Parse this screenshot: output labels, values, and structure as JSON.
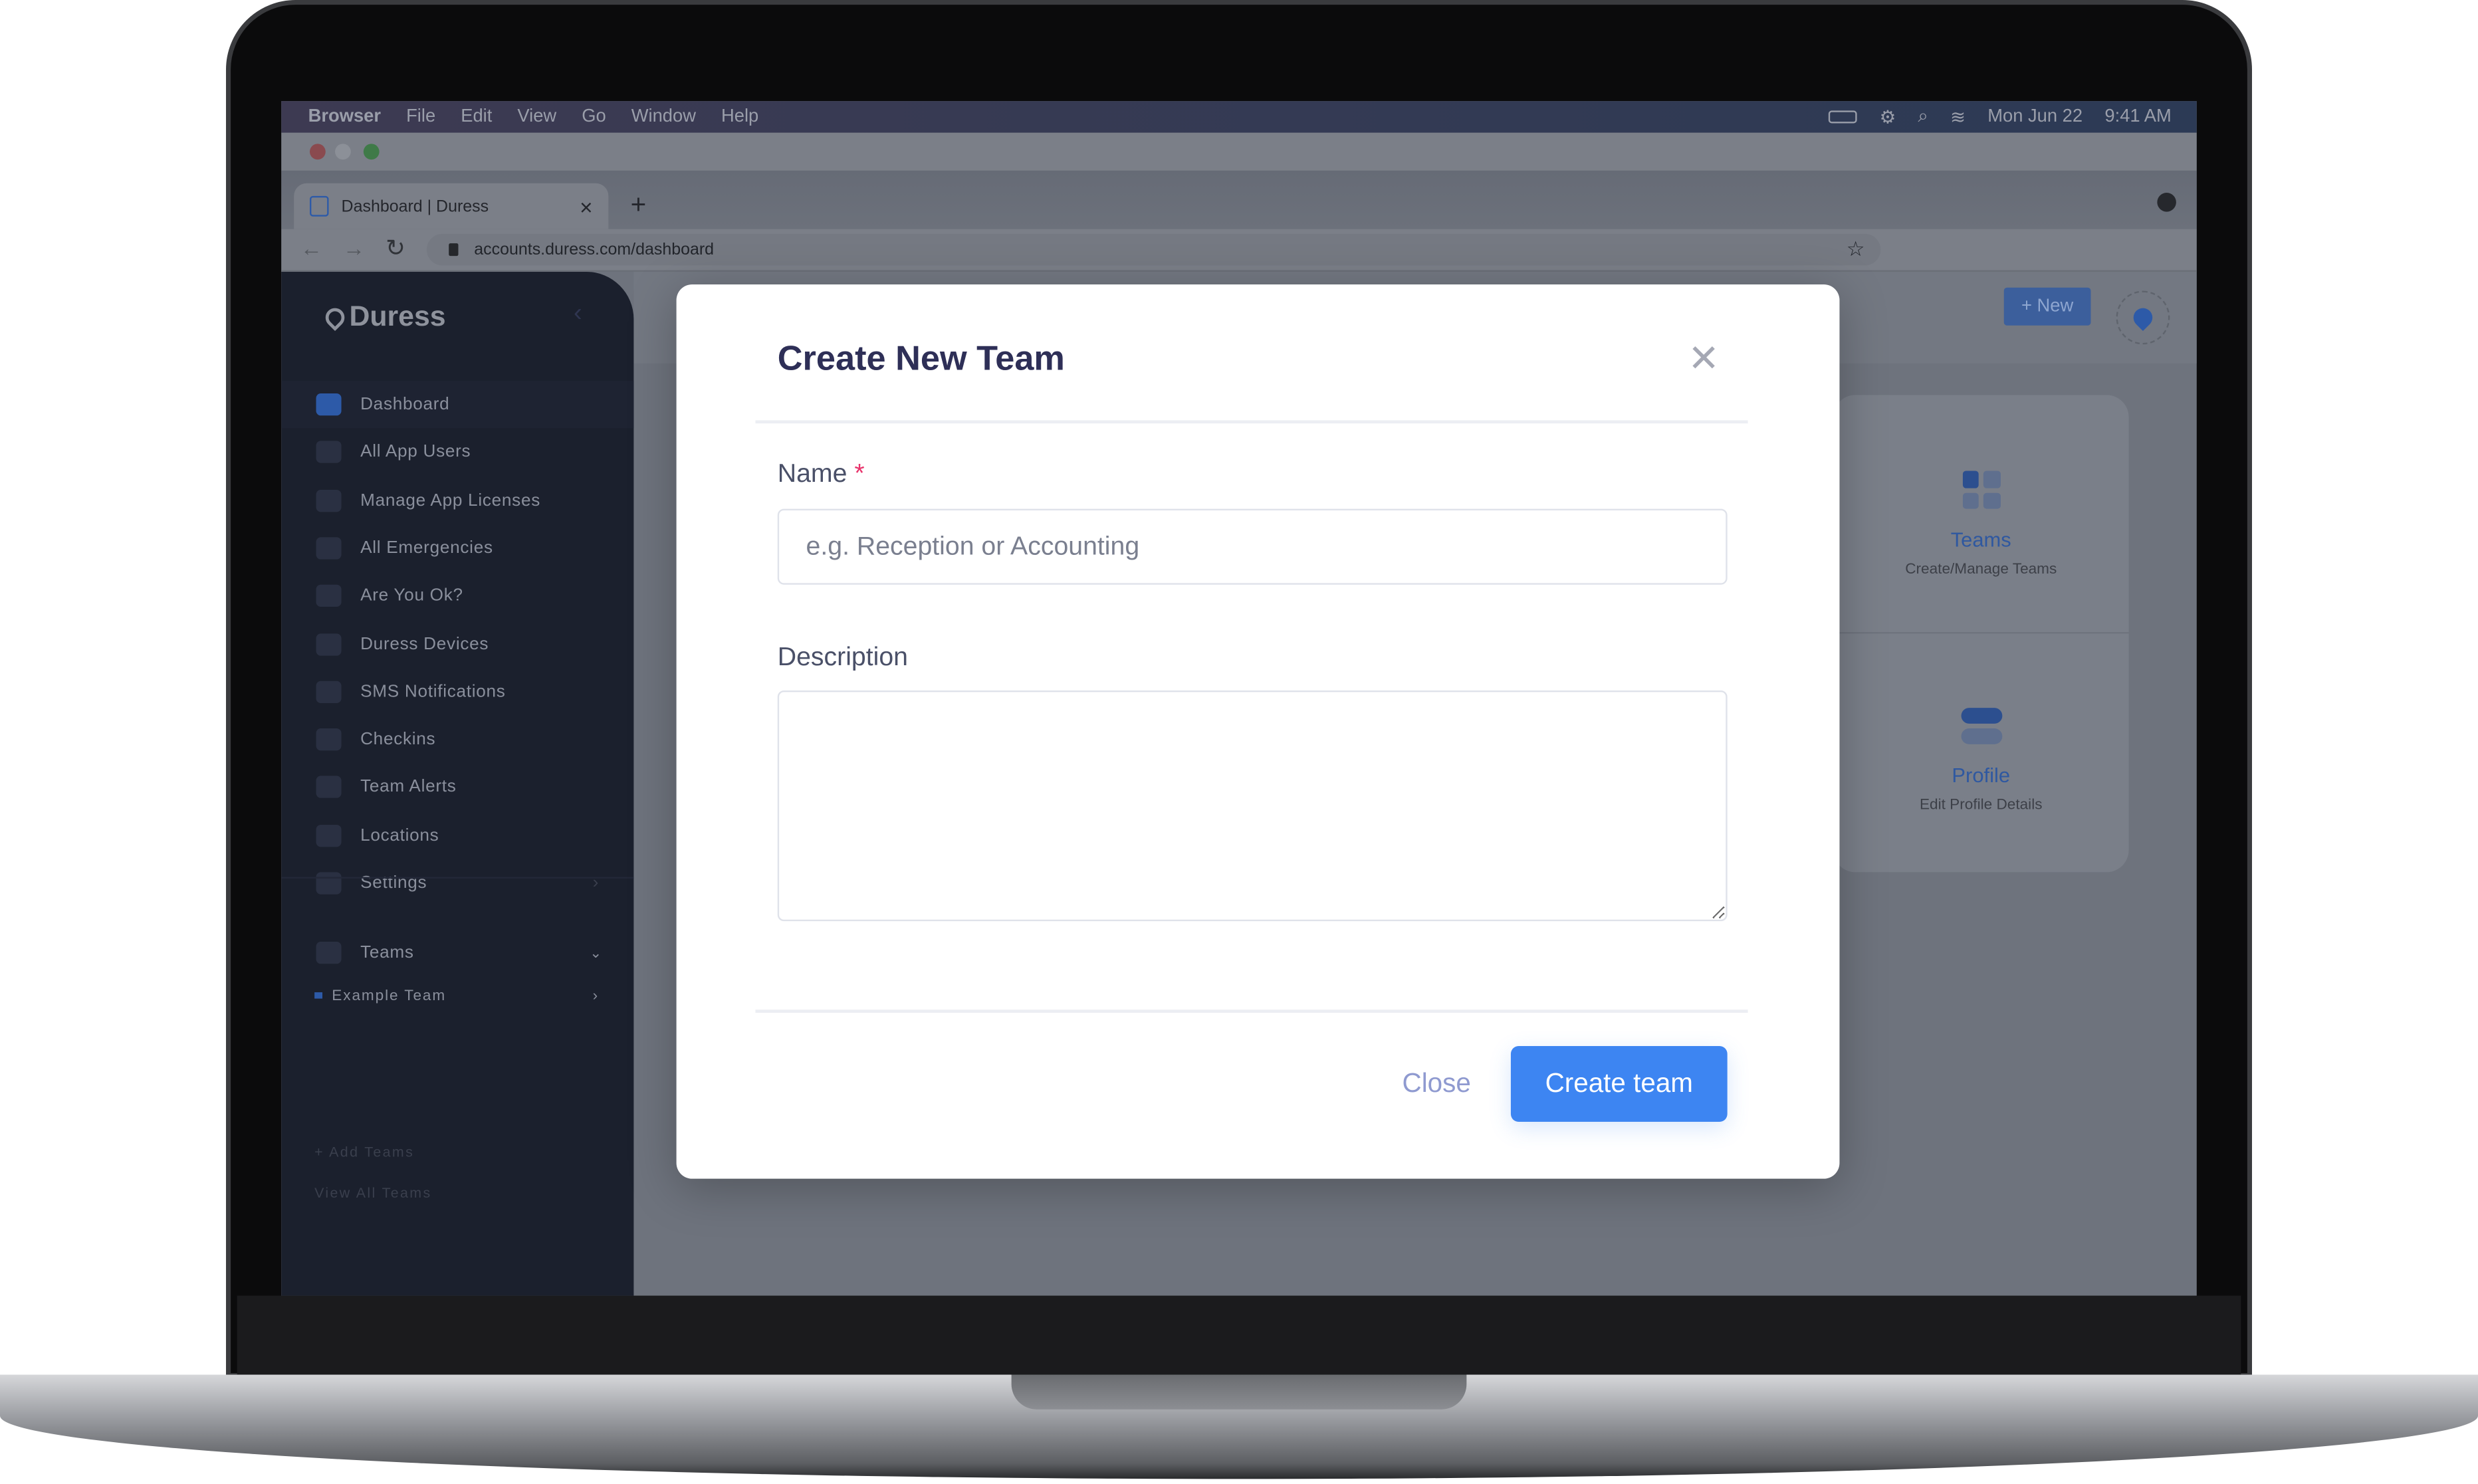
{
  "menubar": {
    "items": [
      "Browser",
      "File",
      "Edit",
      "View",
      "Go",
      "Window",
      "Help"
    ],
    "date": "Mon Jun 22",
    "time": "9:41 AM"
  },
  "browser": {
    "tab_title": "Dashboard | Duress",
    "tab_close": "×",
    "new_tab": "+",
    "url": "accounts.duress.com/dashboard"
  },
  "sidebar": {
    "brand": "Duress",
    "items": [
      {
        "label": "Dashboard",
        "icon": "layers-icon"
      },
      {
        "label": "All App Users",
        "icon": "phone-icon"
      },
      {
        "label": "Manage App Licenses",
        "icon": "license-icon"
      },
      {
        "label": "All Emergencies",
        "icon": "warning-icon"
      },
      {
        "label": "Are You Ok?",
        "icon": "thumbs-up-icon"
      },
      {
        "label": "Duress Devices",
        "icon": "device-icon"
      },
      {
        "label": "SMS Notifications",
        "icon": "chat-icon"
      },
      {
        "label": "Checkins",
        "icon": "map-pin-icon"
      },
      {
        "label": "Team Alerts",
        "icon": "users-icon"
      },
      {
        "label": "Locations",
        "icon": "target-icon"
      },
      {
        "label": "Settings",
        "icon": "gear-icon"
      }
    ],
    "teams_label": "Teams",
    "team_item": "Example Team",
    "add_teams": "+ Add Teams",
    "view_all_teams": "View All Teams"
  },
  "header": {
    "new_button": "+ New"
  },
  "cards": [
    {
      "title": "Teams",
      "subtitle": "Create/Manage Teams"
    },
    {
      "title": "Profile",
      "subtitle": "Edit Profile Details"
    }
  ],
  "modal": {
    "title": "Create New Team",
    "name_label": "Name",
    "required_mark": "*",
    "name_placeholder": "e.g. Reception or Accounting",
    "name_value": "",
    "description_label": "Description",
    "description_value": "",
    "close_button": "Close",
    "create_button": "Create team"
  },
  "colors": {
    "primary": "#3d85f2",
    "title": "#2e2f57",
    "required": "#e8336b",
    "sidebar": "#1b202d"
  }
}
